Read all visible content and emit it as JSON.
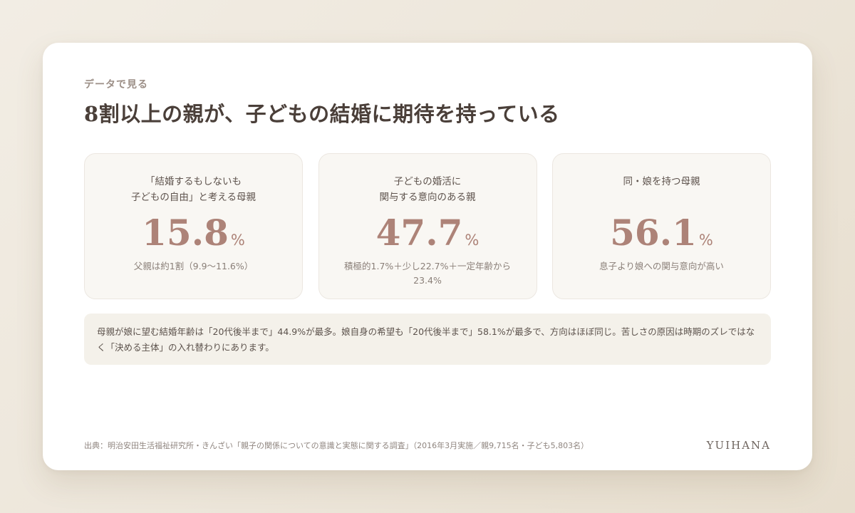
{
  "header": {
    "eyebrow": "データで見る",
    "title": "8割以上の親が、子どもの結婚に期待を持っている"
  },
  "stats": [
    {
      "label_line1": "「結婚するもしないも",
      "label_line2": "子どもの自由」と考える母親",
      "value": "15.8",
      "unit": "%",
      "note": "父親は約1割（9.9〜11.6%）"
    },
    {
      "label_line1": "子どもの婚活に",
      "label_line2": "関与する意向のある親",
      "value": "47.7",
      "unit": "%",
      "note": "積極的1.7%＋少し22.7%＋一定年齢から23.4%"
    },
    {
      "label_line1": "同・娘を持つ母親",
      "label_line2": "",
      "value": "56.1",
      "unit": "%",
      "note": "息子より娘への関与意向が高い"
    }
  ],
  "summary": {
    "text": "母親が娘に望む結婚年齢は「20代後半まで」44.9%が最多。娘自身の希望も「20代後半まで」58.1%が最多で、方向はほぼ同じ。苦しさの原因は時期のズレではなく「決める主体」の入れ替わりにあります。"
  },
  "footer": {
    "source": "出典：明治安田生活福祉研究所・きんざい「親子の関係についての意識と実態に関する調査」（2016年3月実施／親9,715名・子ども5,803名）",
    "brand": "YUIHANA"
  },
  "colors": {
    "accent": "#ad8378",
    "background": "#efe9df",
    "card": "#ffffff",
    "stat_card": "#f9f7f3",
    "summary_bg": "#f4f1ea"
  }
}
